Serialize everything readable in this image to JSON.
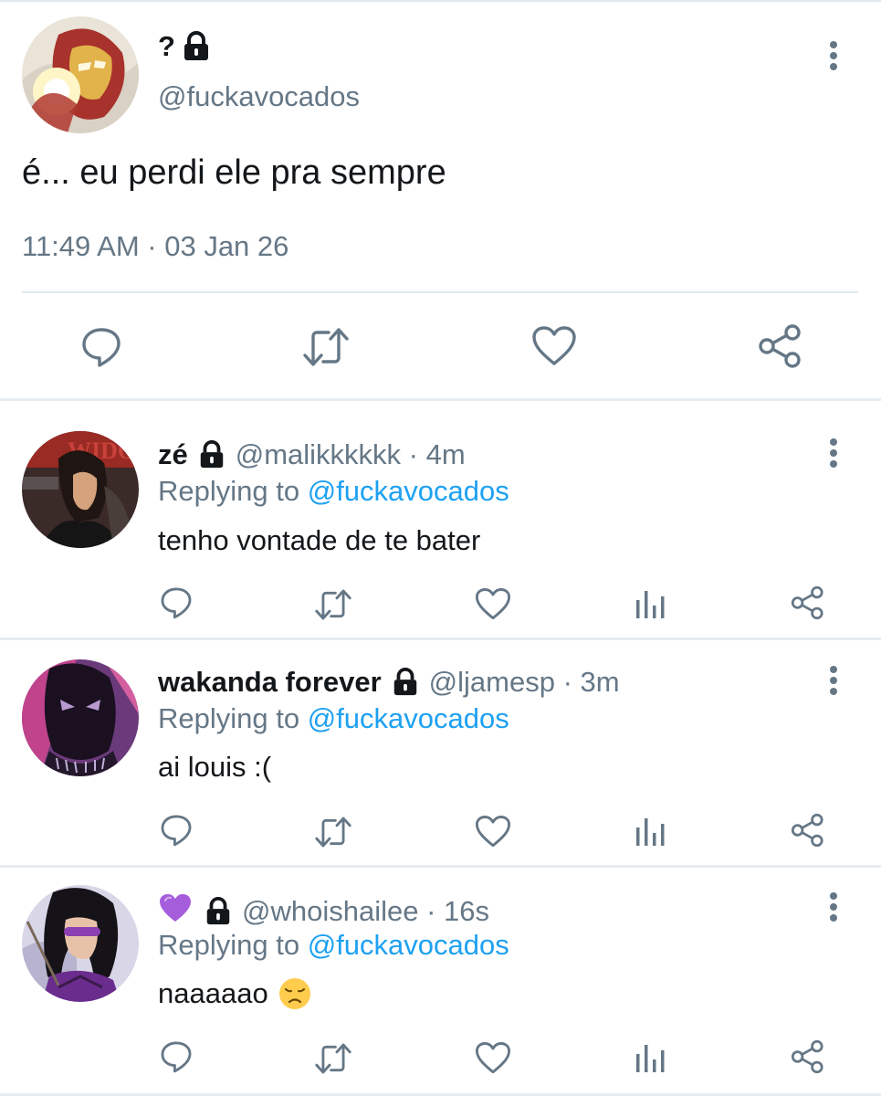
{
  "main_tweet": {
    "name": "?",
    "handle": "@fuckavocados",
    "text": "é... eu perdi ele pra sempre",
    "timestamp": "11:49 AM · 03 Jan 26"
  },
  "replies": [
    {
      "name": "zé",
      "handle_time": "@malikkkkkk · 4m",
      "replying_prefix": "Replying to",
      "replying_to": "@fuckavocados",
      "text": "tenho vontade de te bater"
    },
    {
      "name": "wakanda forever",
      "handle_time": "@ljamesp · 3m",
      "replying_prefix": "Replying to",
      "replying_to": "@fuckavocados",
      "text": "ai louis :("
    },
    {
      "name": "💜",
      "handle_time": "@whoishailee · 16s",
      "replying_prefix": "Replying to",
      "replying_to": "@fuckavocados",
      "text": "naaaaao",
      "emoji": "disappointed-face-icon"
    }
  ],
  "icons": {
    "main_actions": [
      "reply-icon",
      "retweet-icon",
      "like-icon",
      "share-icon"
    ],
    "reply_actions": [
      "reply-icon",
      "retweet-icon",
      "like-icon",
      "analytics-icon",
      "share-icon"
    ],
    "protected": "lock-icon",
    "menu": "more-vertical-icon"
  },
  "colors": {
    "text": "#14171a",
    "secondary": "#657786",
    "link": "#1da1f2",
    "divider": "#e6ecf0",
    "icon": "#657786"
  }
}
